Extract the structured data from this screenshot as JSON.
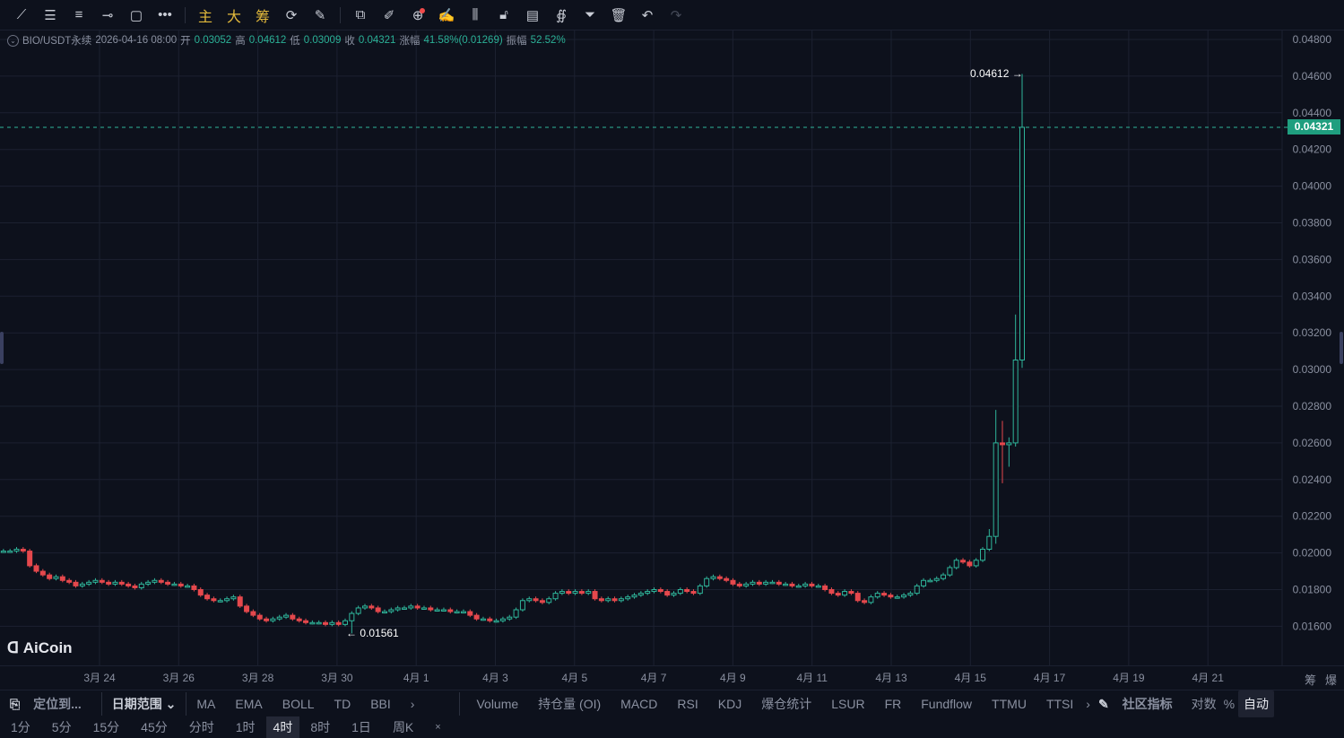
{
  "toolbar": {
    "icons": [
      "trend-line",
      "parallel-lines",
      "horizontal-lines",
      "horizontal-ray",
      "rectangle",
      "more"
    ],
    "gold": [
      "主",
      "大",
      "筹"
    ],
    "right_icons": [
      "replay",
      "measure-pen",
      "ruler",
      "zoom",
      "brush",
      "pattern",
      "lock",
      "edit-list",
      "magnet",
      "filter",
      "trash",
      "undo",
      "redo"
    ]
  },
  "info": {
    "symbol": "BIO/USDT永续",
    "time": "2026-04-16 08:00",
    "open_label": "开",
    "open": "0.03052",
    "high_label": "高",
    "high": "0.04612",
    "low_label": "低",
    "low": "0.03009",
    "close_label": "收",
    "close": "0.04321",
    "change_label": "涨幅",
    "change": "41.58%(0.01269)",
    "amp_label": "振幅",
    "amp": "52.52%"
  },
  "price_axis": [
    "0.04800",
    "0.04600",
    "0.04400",
    "0.04200",
    "0.04000",
    "0.03800",
    "0.03600",
    "0.03400",
    "0.03200",
    "0.03000",
    "0.02800",
    "0.02600",
    "0.02400",
    "0.02200",
    "0.02000",
    "0.01800",
    "0.01600"
  ],
  "last_price": "0.04321",
  "annotations": {
    "high": "0.04612 →",
    "low": "← 0.01561"
  },
  "logo": "AiCoin",
  "date_axis": [
    "3月 24",
    "3月 26",
    "3月 28",
    "3月 30",
    "4月 1",
    "4月 3",
    "4月 5",
    "4月 7",
    "4月 9",
    "4月 11",
    "4月 13",
    "4月 15",
    "4月 17",
    "4月 19",
    "4月 21"
  ],
  "axis_right": [
    "筹",
    "爆"
  ],
  "indicators": {
    "locate": "定位到...",
    "date_range": "日期范围 ⌄",
    "main": [
      "MA",
      "EMA",
      "BOLL",
      "TD",
      "BBI"
    ],
    "more": "›",
    "sub": [
      "Volume",
      "持仓量 (OI)",
      "MACD",
      "RSI",
      "KDJ",
      "爆仓统计",
      "LSUR",
      "FR",
      "Fundflow",
      "TTMU",
      "TTSI"
    ],
    "more2": "›",
    "community": "社区指标",
    "log": "对数",
    "pct": "%",
    "auto": "自动"
  },
  "timeframes": [
    "1分",
    "5分",
    "15分",
    "45分",
    "分时",
    "1时",
    "4时",
    "8时",
    "1日",
    "周K"
  ],
  "active_timeframe": "4时",
  "close_tf": "×",
  "colors": {
    "up": "#2fb59a",
    "down": "#e5484d",
    "bg": "#0d111c",
    "grid": "#1c2130"
  },
  "chart_data": {
    "type": "candlestick",
    "interval": "4h",
    "ylim": [
      0.015,
      0.0488
    ],
    "first_open": 0.0201,
    "closes": [
      0.0201,
      0.0201,
      0.0202,
      0.0201,
      0.0193,
      0.019,
      0.0188,
      0.0186,
      0.0187,
      0.0185,
      0.0184,
      0.0182,
      0.0183,
      0.0184,
      0.0185,
      0.0184,
      0.0183,
      0.0184,
      0.0183,
      0.0182,
      0.0181,
      0.0183,
      0.0184,
      0.0185,
      0.0184,
      0.0183,
      0.0183,
      0.0182,
      0.0182,
      0.018,
      0.0177,
      0.0175,
      0.0174,
      0.0174,
      0.0175,
      0.0176,
      0.0171,
      0.0168,
      0.0166,
      0.0164,
      0.0163,
      0.0164,
      0.0165,
      0.0166,
      0.0164,
      0.0163,
      0.0162,
      0.0162,
      0.0162,
      0.0161,
      0.0162,
      0.0161,
      0.0163,
      0.0167,
      0.017,
      0.0171,
      0.017,
      0.0168,
      0.0168,
      0.0169,
      0.017,
      0.017,
      0.0171,
      0.017,
      0.017,
      0.0169,
      0.0169,
      0.0169,
      0.0168,
      0.0168,
      0.0168,
      0.0166,
      0.0164,
      0.0164,
      0.0163,
      0.0163,
      0.0164,
      0.0165,
      0.0169,
      0.0174,
      0.0175,
      0.0174,
      0.0173,
      0.0175,
      0.0178,
      0.0179,
      0.0178,
      0.0179,
      0.0178,
      0.0179,
      0.0175,
      0.0174,
      0.0175,
      0.0174,
      0.0175,
      0.0176,
      0.0177,
      0.0178,
      0.0179,
      0.018,
      0.0179,
      0.0177,
      0.0178,
      0.018,
      0.0179,
      0.0178,
      0.0182,
      0.0186,
      0.0187,
      0.0186,
      0.0185,
      0.0183,
      0.0182,
      0.0183,
      0.0184,
      0.0183,
      0.0184,
      0.0184,
      0.0183,
      0.0183,
      0.0182,
      0.0182,
      0.0183,
      0.0182,
      0.0182,
      0.018,
      0.0178,
      0.0177,
      0.0179,
      0.0178,
      0.0174,
      0.0173,
      0.0176,
      0.0178,
      0.0177,
      0.0176,
      0.0176,
      0.0177,
      0.0178,
      0.0182,
      0.0185,
      0.0185,
      0.0186,
      0.0188,
      0.0192,
      0.0196,
      0.0195,
      0.0193,
      0.0196,
      0.0202,
      0.0209,
      0.026,
      0.0259,
      0.026,
      0.03052,
      0.04321
    ],
    "overrides": [
      {
        "i": 52,
        "low": 0.01561
      },
      {
        "i": 149,
        "high": 0.0213
      },
      {
        "i": 150,
        "high": 0.0278,
        "low": 0.0205
      },
      {
        "i": 151,
        "high": 0.0272,
        "low": 0.0238
      },
      {
        "i": 152,
        "high": 0.0263,
        "low": 0.0247
      },
      {
        "i": 153,
        "high": 0.033,
        "low": 0.0258
      },
      {
        "i": 154,
        "high": 0.04612,
        "low": 0.03009
      }
    ]
  }
}
